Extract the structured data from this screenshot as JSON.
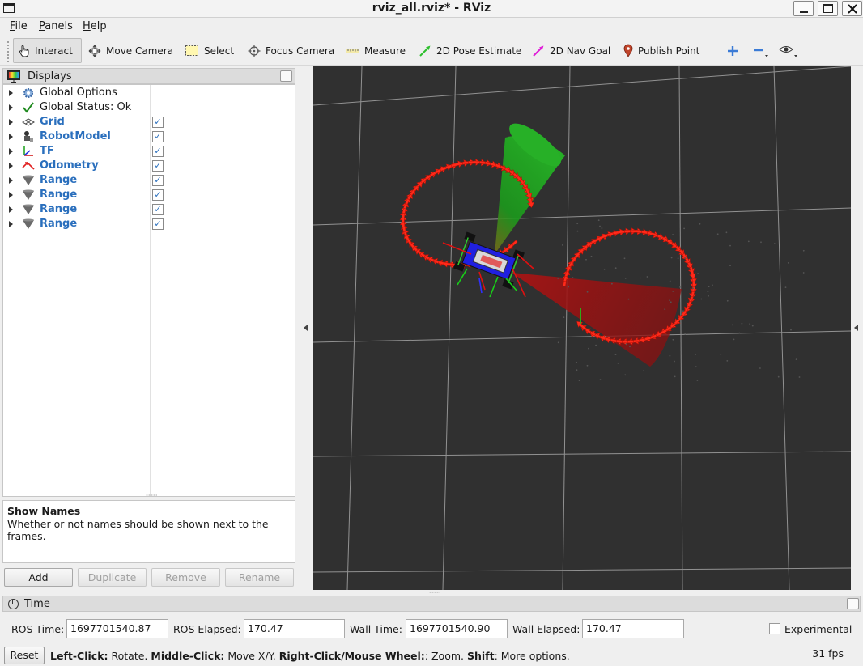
{
  "window": {
    "title": "rviz_all.rviz* - RViz"
  },
  "menu": {
    "file": "File",
    "panels": "Panels",
    "help": "Help"
  },
  "toolbar": {
    "interact": "Interact",
    "move_camera": "Move Camera",
    "select": "Select",
    "focus_camera": "Focus Camera",
    "measure": "Measure",
    "pose_estimate": "2D Pose Estimate",
    "nav_goal": "2D Nav Goal",
    "publish_point": "Publish Point"
  },
  "displays": {
    "title": "Displays",
    "items": [
      {
        "label": "Global Options",
        "icon": "gear-icon",
        "checkable": false,
        "checked": false,
        "style": "normal"
      },
      {
        "label": "Global Status: Ok",
        "icon": "checkmark-icon",
        "checkable": false,
        "checked": false,
        "style": "normal"
      },
      {
        "label": "Grid",
        "icon": "grid-icon",
        "checkable": true,
        "checked": true,
        "style": "blue"
      },
      {
        "label": "RobotModel",
        "icon": "robot-icon",
        "checkable": true,
        "checked": true,
        "style": "blue"
      },
      {
        "label": "TF",
        "icon": "axes-icon",
        "checkable": true,
        "checked": true,
        "style": "blue"
      },
      {
        "label": "Odometry",
        "icon": "odometry-icon",
        "checkable": true,
        "checked": true,
        "style": "blue"
      },
      {
        "label": "Range",
        "icon": "cone-icon",
        "checkable": true,
        "checked": true,
        "style": "blue"
      },
      {
        "label": "Range",
        "icon": "cone-icon",
        "checkable": true,
        "checked": true,
        "style": "blue"
      },
      {
        "label": "Range",
        "icon": "cone-icon",
        "checkable": true,
        "checked": true,
        "style": "blue"
      },
      {
        "label": "Range",
        "icon": "cone-icon",
        "checkable": true,
        "checked": true,
        "style": "blue"
      }
    ],
    "description": {
      "title": "Show Names",
      "text": "Whether or not names should be shown next to the frames."
    },
    "buttons": {
      "add": "Add",
      "duplicate": "Duplicate",
      "remove": "Remove",
      "rename": "Rename"
    }
  },
  "time": {
    "title": "Time",
    "ros_time_label": "ROS Time:",
    "ros_time": "1697701540.87",
    "ros_elapsed_label": "ROS Elapsed:",
    "ros_elapsed": "170.47",
    "wall_time_label": "Wall Time:",
    "wall_time": "1697701540.90",
    "wall_elapsed_label": "Wall Elapsed:",
    "wall_elapsed": "170.47",
    "experimental": "Experimental"
  },
  "status": {
    "reset": "Reset",
    "hint_left_b": "Left-Click:",
    "hint_left": " Rotate. ",
    "hint_middle_b": "Middle-Click:",
    "hint_middle": " Move X/Y. ",
    "hint_right_b": "Right-Click/Mouse Wheel:",
    "hint_right": ": Zoom. ",
    "hint_shift_b": "Shift",
    "hint_shift": ": More options.",
    "fps": "31 fps"
  },
  "colors": {
    "viewport_bg": "#303030",
    "grid": "#a0a0a0",
    "odometry_arrows": "#ff2a1a",
    "range_green": "#1fa51f",
    "range_red": "#c81e1e",
    "display_label": "#2a6fbd"
  }
}
